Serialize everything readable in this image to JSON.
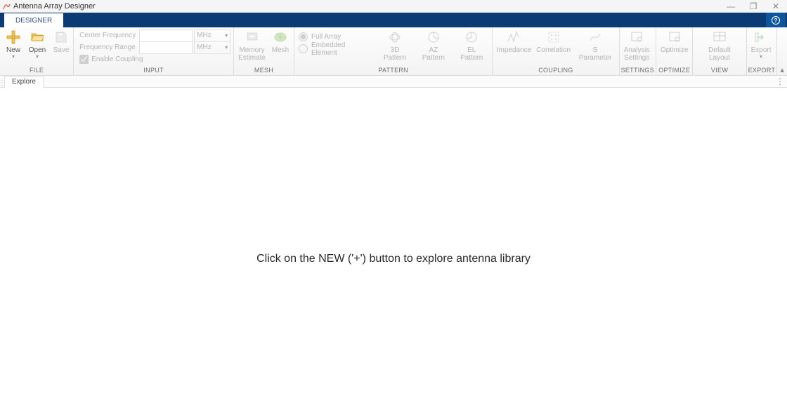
{
  "window": {
    "title": "Antenna Array Designer"
  },
  "tab_strip": {
    "tabs": [
      "DESIGNER"
    ]
  },
  "ribbon": {
    "file": {
      "label": "FILE",
      "new": "New",
      "open": "Open",
      "save": "Save"
    },
    "input": {
      "label": "INPUT",
      "center_freq_label": "Center Frequency",
      "freq_range_label": "Frequency Range",
      "enable_coupling_label": "Enable Coupling",
      "unit": "MHz"
    },
    "mesh": {
      "label": "MESH",
      "memory_estimate": "Memory\nEstimate",
      "mesh": "Mesh"
    },
    "pattern": {
      "label": "PATTERN",
      "full_array": "Full Array",
      "embedded_element": "Embedded Element",
      "three_d": "3D Pattern",
      "az": "AZ Pattern",
      "el": "EL Pattern"
    },
    "coupling": {
      "label": "COUPLING",
      "impedance": "Impedance",
      "correlation": "Correlation",
      "s_parameter": "S Parameter"
    },
    "settings": {
      "label": "SETTINGS",
      "analysis_settings": "Analysis\nSettings"
    },
    "optimize": {
      "label": "OPTIMIZE",
      "optimize": "Optimize"
    },
    "view": {
      "label": "VIEW",
      "default_layout": "Default Layout"
    },
    "export": {
      "label": "EXPORT",
      "export": "Export"
    }
  },
  "subtab": {
    "label": "Explore"
  },
  "canvas_message": "Click on the NEW ('+') button to explore antenna library"
}
